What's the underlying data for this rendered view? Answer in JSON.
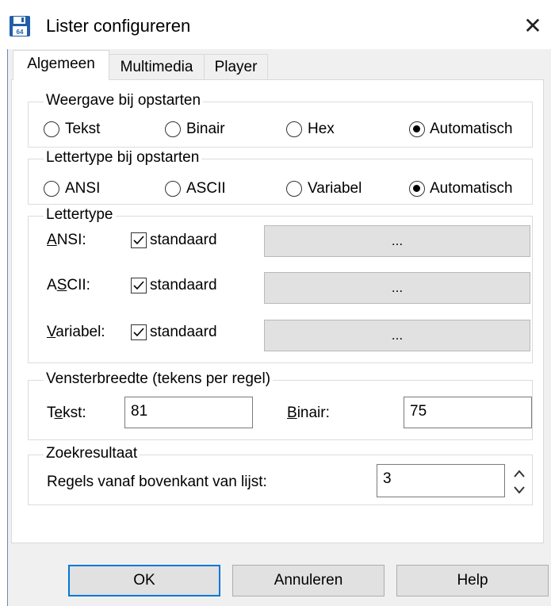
{
  "window": {
    "title": "Lister configureren",
    "close_glyph": "✕",
    "icon": "floppy-disk-icon"
  },
  "tabs": [
    {
      "label": "Algemeen",
      "active": true
    },
    {
      "label": "Multimedia",
      "active": false
    },
    {
      "label": "Player",
      "active": false
    }
  ],
  "startup_view": {
    "legend": "Weergave bij opstarten",
    "options": [
      {
        "label": "Tekst",
        "selected": false
      },
      {
        "label": "Binair",
        "selected": false
      },
      {
        "label": "Hex",
        "selected": false
      },
      {
        "label": "Automatisch",
        "selected": true
      }
    ]
  },
  "startup_font": {
    "legend": "Lettertype bij opstarten",
    "options": [
      {
        "label": "ANSI",
        "selected": false
      },
      {
        "label": "ASCII",
        "selected": false
      },
      {
        "label": "Variabel",
        "selected": false
      },
      {
        "label": "Automatisch",
        "selected": true
      }
    ]
  },
  "font": {
    "legend": "Lettertype",
    "rows": [
      {
        "label_pre": "",
        "label_key": "A",
        "label_post": "NSI:",
        "check_label": "standaard",
        "checked": true,
        "button": "..."
      },
      {
        "label_pre": "A",
        "label_key": "S",
        "label_post": "CII:",
        "check_label": "standaard",
        "checked": true,
        "button": "..."
      },
      {
        "label_pre": "",
        "label_key": "V",
        "label_post": "ariabel:",
        "check_label": "standaard",
        "checked": true,
        "button": "..."
      }
    ]
  },
  "width": {
    "legend": "Vensterbreedte (tekens per regel)",
    "text_label_pre": "T",
    "text_label_key": "e",
    "text_label_post": "kst:",
    "text_value": "81",
    "binary_label_pre": "",
    "binary_label_key": "B",
    "binary_label_post": "inair:",
    "binary_value": "75"
  },
  "search": {
    "legend": "Zoekresultaat",
    "label": "Regels vanaf bovenkant van lijst:",
    "value": "3"
  },
  "buttons": {
    "ok": "OK",
    "cancel": "Annuleren",
    "help": "Help"
  },
  "colors": {
    "default_button_border": "#0078d7",
    "window_background": "#f0f0f0"
  }
}
